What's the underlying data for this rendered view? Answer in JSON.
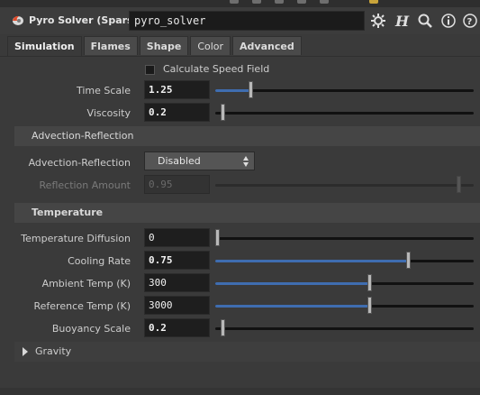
{
  "header": {
    "node_type": "Pyro Solver (Sparse)",
    "node_name": "pyro_solver",
    "buttons": [
      "gear-icon",
      "help-H-icon",
      "search-icon",
      "info-icon",
      "question-icon"
    ]
  },
  "tabs": [
    "Simulation",
    "Flames",
    "Shape",
    "Color",
    "Advanced"
  ],
  "active_tab": "Simulation",
  "params": {
    "calculate_speed_field": {
      "label": "Calculate Speed Field",
      "checked": false
    },
    "time_scale": {
      "label": "Time Scale",
      "value": "1.25",
      "fraction": 0.13
    },
    "viscosity": {
      "label": "Viscosity",
      "value": "0.2",
      "fraction": 0.02
    },
    "advection_section": "Advection-Reflection",
    "advection_reflection": {
      "label": "Advection-Reflection",
      "value": "Disabled"
    },
    "reflection_amount": {
      "label": "Reflection Amount",
      "value": "0.95",
      "fraction": 0.95
    },
    "temperature_section": "Temperature",
    "temperature_diffusion": {
      "label": "Temperature Diffusion",
      "value": "0",
      "fraction": 0.0
    },
    "cooling_rate": {
      "label": "Cooling Rate",
      "value": "0.75",
      "fraction": 0.75
    },
    "ambient_temp": {
      "label": "Ambient Temp (K)",
      "value": "300",
      "fraction": 0.6
    },
    "reference_temp": {
      "label": "Reference Temp (K)",
      "value": "3000",
      "fraction": 0.6
    },
    "buoyancy_scale": {
      "label": "Buoyancy Scale",
      "value": "0.2",
      "fraction": 0.02
    },
    "gravity_folder": "Gravity"
  },
  "colors": {
    "accent": "#3f6db0",
    "background": "#3a3a3a",
    "field": "#1e1e1e"
  }
}
